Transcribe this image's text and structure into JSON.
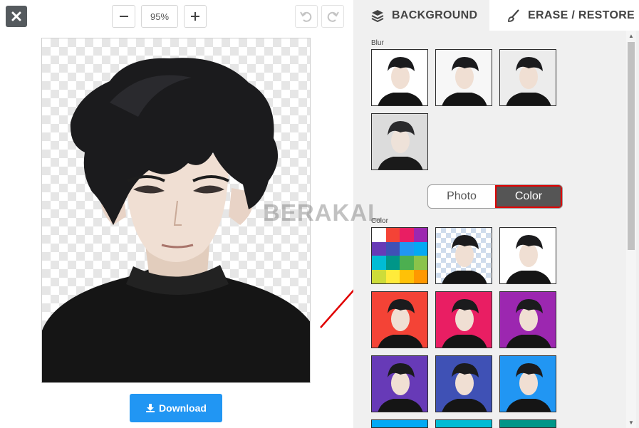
{
  "toolbar": {
    "zoom_value": "95%",
    "download_label": "Download"
  },
  "tabs": {
    "background": "BACKGROUND",
    "erase_restore": "ERASE / RESTORE"
  },
  "sections": {
    "blur_label": "Blur",
    "color_label": "Color"
  },
  "toggle": {
    "photo": "Photo",
    "color": "Color",
    "selected": "Color"
  },
  "watermark": "BERAKAL",
  "colors": {
    "download": "#2196f3",
    "highlight": "#e00000",
    "toggle_active": "#555555",
    "swatch_red": "#f44336",
    "swatch_pink": "#e91e63",
    "swatch_purple": "#9c27b0",
    "swatch_deep_purple": "#673ab7",
    "swatch_indigo": "#3f51b5",
    "swatch_blue": "#2196f3"
  },
  "palette_swatches": [
    "#ffffff",
    "#f44336",
    "#e91e63",
    "#9c27b0",
    "#673ab7",
    "#3f51b5",
    "#2196f3",
    "#03a9f4",
    "#00bcd4",
    "#009688",
    "#4caf50",
    "#8bc34a",
    "#cddc39",
    "#ffeb3b",
    "#ffc107",
    "#ff9800"
  ],
  "icons": {
    "close": "close-icon",
    "zoom_out": "minus-icon",
    "zoom_in": "plus-icon",
    "undo": "undo-icon",
    "redo": "redo-icon",
    "background_tab": "layers-icon",
    "erase_tab": "brush-icon",
    "download": "download-icon"
  }
}
